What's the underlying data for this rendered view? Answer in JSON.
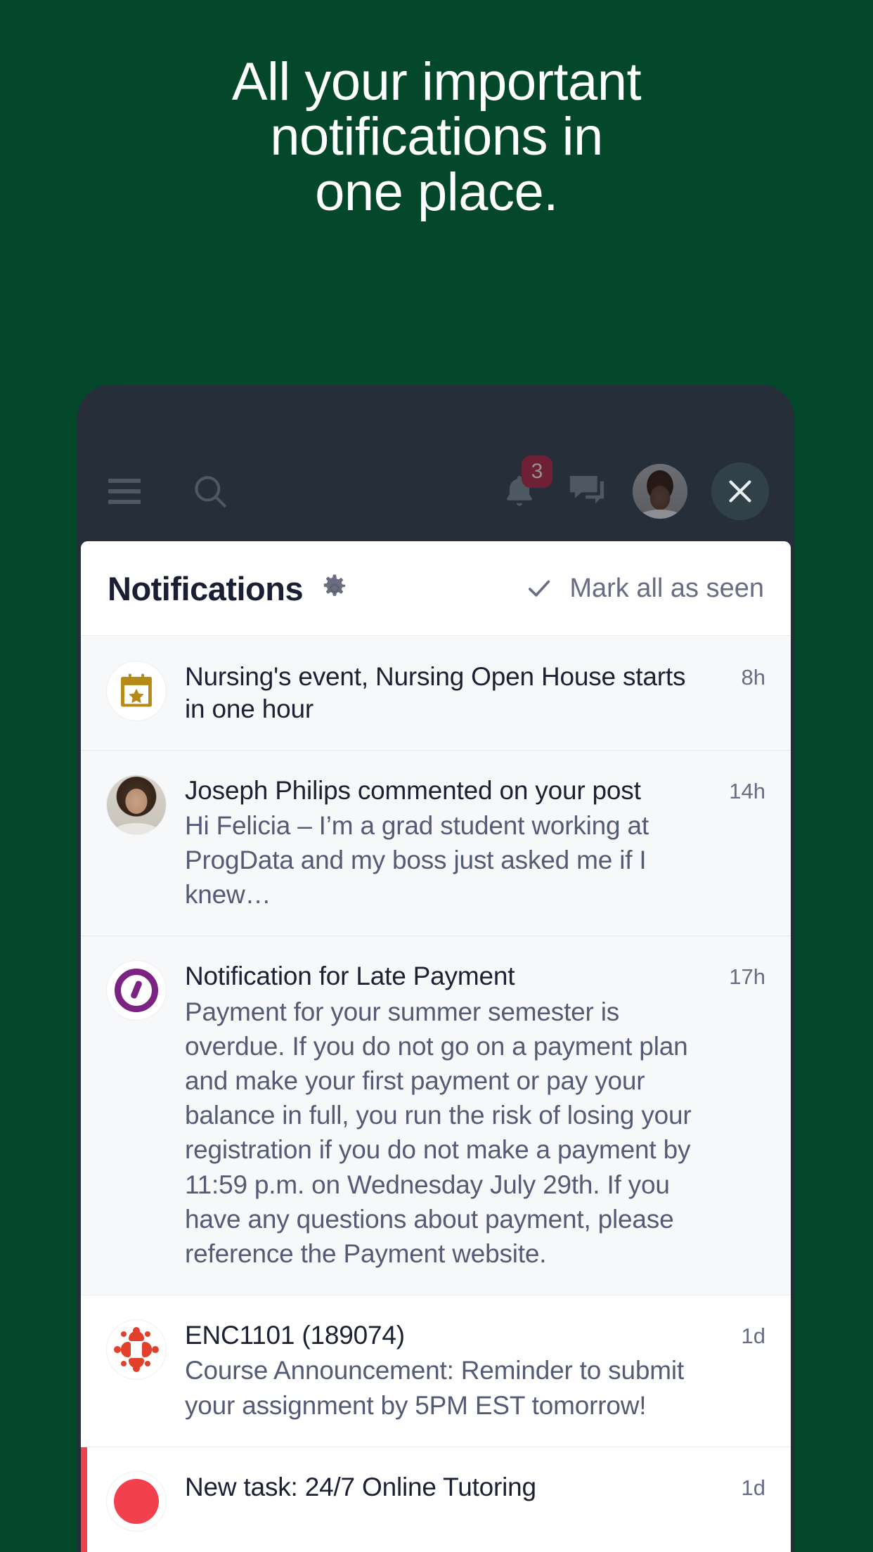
{
  "headline": {
    "line1": "All your important",
    "line2": "notifications in",
    "line3": "one place."
  },
  "colors": {
    "background": "#04482c",
    "phone_frame": "#262f39",
    "sheet": "#ffffff",
    "badge": "#6e2134",
    "alert_stripe": "#f0414c",
    "calendar_icon": "#b58a16",
    "ellucian_purple": "#7b2382",
    "canvas_red": "#e2402a",
    "muted_text": "#555b75",
    "title_text": "#1c2033"
  },
  "appbar": {
    "menu_icon": "hamburger-menu-icon",
    "search_icon": "search-icon",
    "notifications_icon": "bell-icon",
    "notifications_badge": "3",
    "messages_icon": "chat-bubble-icon",
    "avatar_icon": "user-avatar",
    "close_icon": "close-x-icon"
  },
  "sheet": {
    "title": "Notifications",
    "settings_icon": "gear-icon",
    "mark_all_icon": "check-icon",
    "mark_all_label": "Mark all as seen"
  },
  "notifications": [
    {
      "icon": "calendar-star-icon",
      "title": "Nursing's event, Nursing Open House starts in one hour",
      "body": "",
      "time": "8h"
    },
    {
      "icon": "user-avatar-joseph",
      "title": "Joseph Philips commented on your post",
      "body": "Hi Felicia – I’m a grad student working at ProgData and my boss just asked me if I knew…",
      "time": "14h"
    },
    {
      "icon": "ellucian-logo-icon",
      "title": "Notification for Late Payment",
      "body": "Payment for your summer semester is overdue.  If you do not go on a payment plan and make your first payment or pay your balance in full, you run the risk of losing your registration if you do not make a payment by 11:59 p.m. on Wednesday July 29th.  If you have any questions about payment, please reference the Payment website.",
      "time": "17h"
    },
    {
      "icon": "canvas-logo-icon",
      "title": "ENC1101 (189074)",
      "body": "Course Announcement: Reminder to submit your assignment by 5PM EST tomorrow!",
      "time": "1d"
    },
    {
      "icon": "task-alert-icon",
      "title": "New task: 24/7 Online Tutoring",
      "body": "",
      "time": "1d"
    }
  ]
}
